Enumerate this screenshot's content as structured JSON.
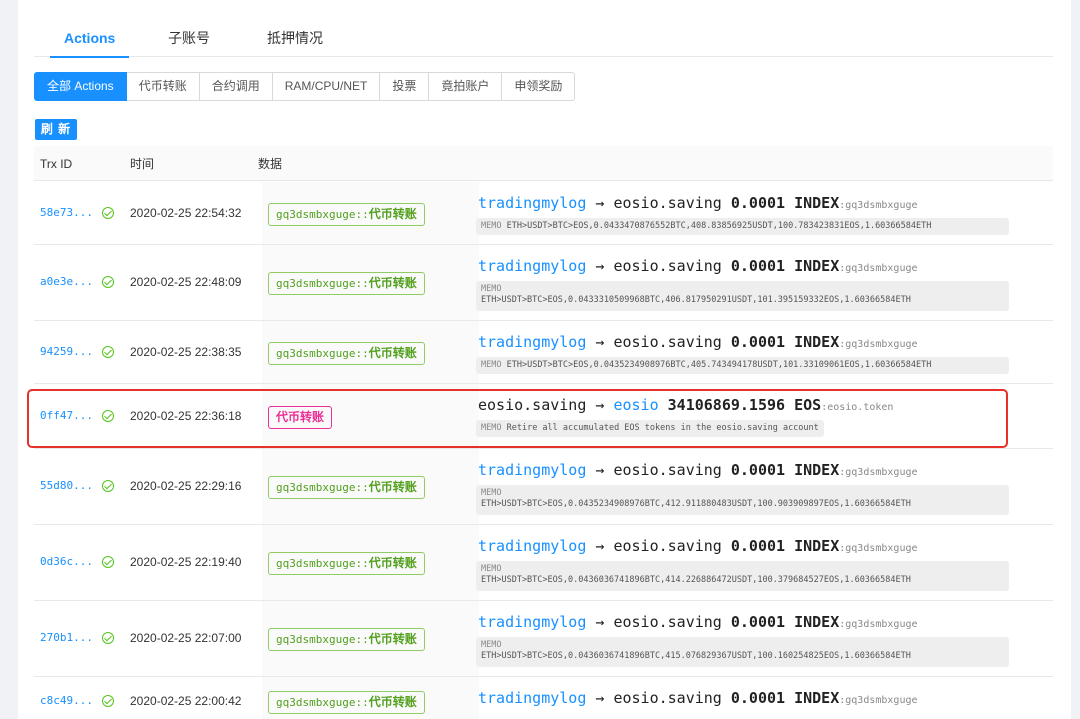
{
  "tabs": [
    "Actions",
    "子账号",
    "抵押情况"
  ],
  "filters": [
    "全部 Actions",
    "代币转账",
    "合约调用",
    "RAM/CPU/NET",
    "投票",
    "竟拍账户",
    "申领奖励"
  ],
  "refresh_label": "刷 新",
  "table": {
    "headers": [
      "Trx ID",
      "时间",
      "数据"
    ],
    "rows": [
      {
        "id": "58e73...",
        "time": "2020-02-25 22:54:32",
        "tag_account": "gq3dsmbxguge",
        "tag_sep": "::",
        "tag_action": "代币转账",
        "from": "tradingmylog",
        "arrow": "→",
        "to": "eosio.saving",
        "amount": "0.0001",
        "symbol": "INDEX",
        "contract": ":gq3dsmbxguge",
        "memo_label": "MEMO",
        "memo": "ETH>USDT>BTC>EOS,0.0433470876552BTC,408.83856925USDT,100.783423831EOS,1.60366584ETH"
      },
      {
        "id": "a0e3e...",
        "time": "2020-02-25 22:48:09",
        "tag_account": "gq3dsmbxguge",
        "tag_sep": "::",
        "tag_action": "代币转账",
        "from": "tradingmylog",
        "arrow": "→",
        "to": "eosio.saving",
        "amount": "0.0001",
        "symbol": "INDEX",
        "contract": ":gq3dsmbxguge",
        "memo_label": "MEMO",
        "memo": "ETH>USDT>BTC>EOS,0.0433310509968BTC,406.817950291USDT,101.395159332EOS,1.60366584ETH"
      },
      {
        "id": "94259...",
        "time": "2020-02-25 22:38:35",
        "tag_account": "gq3dsmbxguge",
        "tag_sep": "::",
        "tag_action": "代币转账",
        "from": "tradingmylog",
        "arrow": "→",
        "to": "eosio.saving",
        "amount": "0.0001",
        "symbol": "INDEX",
        "contract": ":gq3dsmbxguge",
        "memo_label": "MEMO",
        "memo": "ETH>USDT>BTC>EOS,0.0435234908976BTC,405.743494178USDT,101.33109061EOS,1.60366584ETH"
      },
      {
        "id": "0ff47...",
        "time": "2020-02-25 22:36:18",
        "tag_account": "",
        "tag_sep": "",
        "tag_action": "代币转账",
        "from": "eosio.saving",
        "arrow": "→",
        "to": "eosio",
        "amount": "34106869.1596",
        "symbol": "EOS",
        "contract": ":eosio.token",
        "memo_label": "MEMO",
        "memo": "Retire all accumulated EOS tokens in the eosio.saving account"
      },
      {
        "id": "55d80...",
        "time": "2020-02-25 22:29:16",
        "tag_account": "gq3dsmbxguge",
        "tag_sep": "::",
        "tag_action": "代币转账",
        "from": "tradingmylog",
        "arrow": "→",
        "to": "eosio.saving",
        "amount": "0.0001",
        "symbol": "INDEX",
        "contract": ":gq3dsmbxguge",
        "memo_label": "MEMO",
        "memo": "ETH>USDT>BTC>EOS,0.0435234908976BTC,412.911880483USDT,100.903909897EOS,1.60366584ETH"
      },
      {
        "id": "0d36c...",
        "time": "2020-02-25 22:19:40",
        "tag_account": "gq3dsmbxguge",
        "tag_sep": "::",
        "tag_action": "代币转账",
        "from": "tradingmylog",
        "arrow": "→",
        "to": "eosio.saving",
        "amount": "0.0001",
        "symbol": "INDEX",
        "contract": ":gq3dsmbxguge",
        "memo_label": "MEMO",
        "memo": "ETH>USDT>BTC>EOS,0.0436036741896BTC,414.226886472USDT,100.379684527EOS,1.60366584ETH"
      },
      {
        "id": "270b1...",
        "time": "2020-02-25 22:07:00",
        "tag_account": "gq3dsmbxguge",
        "tag_sep": "::",
        "tag_action": "代币转账",
        "from": "tradingmylog",
        "arrow": "→",
        "to": "eosio.saving",
        "amount": "0.0001",
        "symbol": "INDEX",
        "contract": ":gq3dsmbxguge",
        "memo_label": "MEMO",
        "memo": "ETH>USDT>BTC>EOS,0.0436036741896BTC,415.076829367USDT,100.160254825EOS,1.60366584ETH"
      },
      {
        "id": "c8c49...",
        "time": "2020-02-25 22:00:42",
        "tag_account": "gq3dsmbxguge",
        "tag_sep": "::",
        "tag_action": "代币转账",
        "from": "tradingmylog",
        "arrow": "→",
        "to": "eosio.saving",
        "amount": "0.0001",
        "symbol": "INDEX",
        "contract": ":gq3dsmbxguge",
        "memo_label": "",
        "memo": ""
      }
    ]
  }
}
